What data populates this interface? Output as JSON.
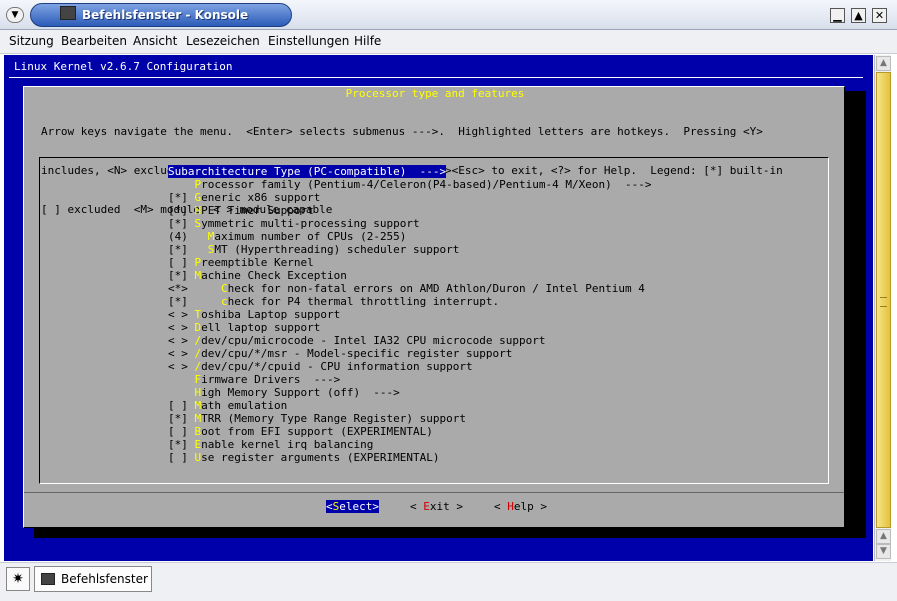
{
  "window": {
    "title": "Befehlsfenster - Konsole",
    "menu_icon": "chevron-down-icon",
    "app_icon": "terminal-icon",
    "minimize_glyph": "▁",
    "maximize_glyph": "▲",
    "close_glyph": "✕"
  },
  "menubar": [
    "Sitzung",
    "Bearbeiten",
    "Ansicht",
    "Lesezeichen",
    "Einstellungen",
    "Hilfe"
  ],
  "terminal": {
    "header": "Linux Kernel v2.6.7 Configuration",
    "dialog": {
      "title": "Processor type and features",
      "help_lines": [
        "Arrow keys navigate the menu.  <Enter> selects submenus --->.  Highlighted letters are hotkeys.  Pressing <Y>",
        "includes, <N> excludes, <M> modularizes features.  Press <Esc><Esc> to exit, <?> for Help.  Legend: [*] built-in",
        "[ ] excluded  <M> module  < > module capable"
      ],
      "items": [
        {
          "prefix": "",
          "hot": "S",
          "rest": "ubarchitecture Type (PC-compatible)  --->",
          "selected": true
        },
        {
          "prefix": "    ",
          "hot": "P",
          "rest": "rocessor family (Pentium-4/Celeron(P4-based)/Pentium-4 M/Xeon)  --->",
          "selected": false
        },
        {
          "prefix": "[*] ",
          "hot": "G",
          "rest": "eneric x86 support",
          "selected": false
        },
        {
          "prefix": "[*] ",
          "hot": "H",
          "rest": "PET Timer Support",
          "selected": false
        },
        {
          "prefix": "[*] ",
          "hot": "S",
          "rest": "ymmetric multi-processing support",
          "selected": false
        },
        {
          "prefix": "(4)   ",
          "hot": "M",
          "rest": "aximum number of CPUs (2-255)",
          "selected": false
        },
        {
          "prefix": "[*]   ",
          "hot": "S",
          "rest": "MT (Hyperthreading) scheduler support",
          "selected": false
        },
        {
          "prefix": "[ ] ",
          "hot": "P",
          "rest": "reemptible Kernel",
          "selected": false
        },
        {
          "prefix": "[*] ",
          "hot": "M",
          "rest": "achine Check Exception",
          "selected": false
        },
        {
          "prefix": "<*>     ",
          "hot": "C",
          "rest": "heck for non-fatal errors on AMD Athlon/Duron / Intel Pentium 4",
          "selected": false
        },
        {
          "prefix": "[*]     ",
          "hot": "c",
          "rest": "heck for P4 thermal throttling interrupt.",
          "selected": false
        },
        {
          "prefix": "< > ",
          "hot": "T",
          "rest": "oshiba Laptop support",
          "selected": false
        },
        {
          "prefix": "< > ",
          "hot": "D",
          "rest": "ell laptop support",
          "selected": false
        },
        {
          "prefix": "< > ",
          "hot": "/",
          "rest": "dev/cpu/microcode - Intel IA32 CPU microcode support",
          "selected": false
        },
        {
          "prefix": "< > ",
          "hot": "/",
          "rest": "dev/cpu/*/msr - Model-specific register support",
          "selected": false
        },
        {
          "prefix": "< > ",
          "hot": "/",
          "rest": "dev/cpu/*/cpuid - CPU information support",
          "selected": false
        },
        {
          "prefix": "    ",
          "hot": "F",
          "rest": "irmware Drivers  --->",
          "selected": false
        },
        {
          "prefix": "    ",
          "hot": "H",
          "rest": "igh Memory Support (off)  --->",
          "selected": false
        },
        {
          "prefix": "[ ] ",
          "hot": "M",
          "rest": "ath emulation",
          "selected": false
        },
        {
          "prefix": "[*] ",
          "hot": "M",
          "rest": "TRR (Memory Type Range Register) support",
          "selected": false
        },
        {
          "prefix": "[ ] ",
          "hot": "B",
          "rest": "oot from EFI support (EXPERIMENTAL)",
          "selected": false
        },
        {
          "prefix": "[*] ",
          "hot": "E",
          "rest": "nable kernel irq balancing",
          "selected": false
        },
        {
          "prefix": "[ ] ",
          "hot": "U",
          "rest": "se register arguments (EXPERIMENTAL)",
          "selected": false
        }
      ],
      "buttons": {
        "select": {
          "first": "S",
          "rest": "elect"
        },
        "exit": {
          "first": "E",
          "rest": "xit"
        },
        "help": {
          "first": "H",
          "rest": "elp"
        }
      }
    }
  },
  "scrollbar": {
    "up_glyph": "▲",
    "down_glyph": "▼"
  },
  "taskbar": {
    "start_icon": "star-icon",
    "task_label": "Befehlsfenster"
  }
}
